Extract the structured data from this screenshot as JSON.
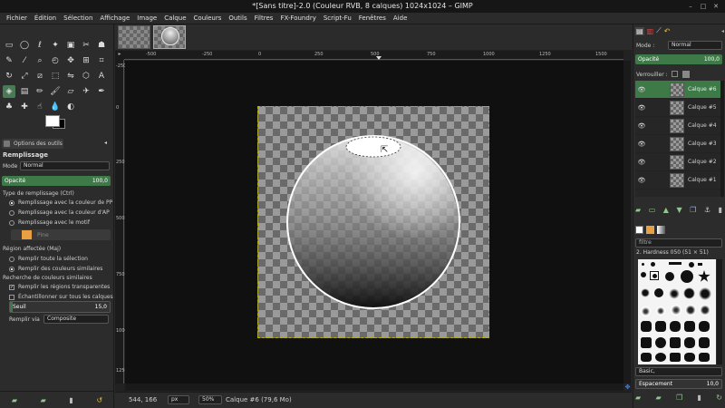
{
  "window": {
    "title": "*[Sans titre]-2.0 (Couleur RVB, 8 calques) 1024x1024 – GIMP"
  },
  "menu": [
    "Fichier",
    "Édition",
    "Sélection",
    "Affichage",
    "Image",
    "Calque",
    "Couleurs",
    "Outils",
    "Filtres",
    "FX-Foundry",
    "Script-Fu",
    "Fenêtres",
    "Aide"
  ],
  "tool_options": {
    "tab_label": "Options des outils",
    "tool_name": "Remplissage",
    "mode_label": "Mode :",
    "mode_value": "Normal",
    "opacity_label": "Opacité",
    "opacity_value": "100,0",
    "fill_type_label": "Type de remplissage (Ctrl)",
    "fill_type_options": [
      "Remplissage avec la couleur de PP",
      "Remplissage avec la couleur d'AP",
      "Remplissage avec le motif"
    ],
    "pattern_name": "Pine",
    "region_label": "Région affectée (Maj)",
    "region_options": [
      "Remplir toute la sélection",
      "Remplir des couleurs similaires"
    ],
    "similar_label": "Recherche de couleurs similaires",
    "similar_options": [
      "Remplir les régions transparentes",
      "Échantillonner sur tous les calques"
    ],
    "threshold_label": "Seuil",
    "threshold_value": "15,0",
    "fill_by_label": "Remplir via",
    "fill_by_value": "Composite"
  },
  "ruler": {
    "h_labels": [
      "-500",
      "-250",
      "0",
      "250",
      "500",
      "750",
      "1000",
      "1250",
      "1500"
    ],
    "v_labels": [
      "-250",
      "0",
      "250",
      "500",
      "750",
      "1000",
      "1250"
    ]
  },
  "status": {
    "coords": "544, 166",
    "unit": "px",
    "zoom": "50%",
    "info": "Calque #6 (79,6 Mo)"
  },
  "layers_panel": {
    "mode_label": "Mode :",
    "mode_value": "Normal",
    "opacity_label": "Opacité",
    "opacity_value": "100,0",
    "lock_label": "Verrouiller :",
    "layers": [
      "Calque #6",
      "Calque #5",
      "Calque #4",
      "Calque #3",
      "Calque #2",
      "Calque #1"
    ]
  },
  "brushes_panel": {
    "filter_value": "filtre",
    "brush_name": "2. Hardness 050 (51 × 51)",
    "tag_value": "Basic,",
    "spacing_label": "Espacement",
    "spacing_value": "10,0"
  },
  "colors": {
    "accent": "#3e7a48",
    "canvas_bg": "#101010",
    "selection_border": "#b7b000"
  }
}
